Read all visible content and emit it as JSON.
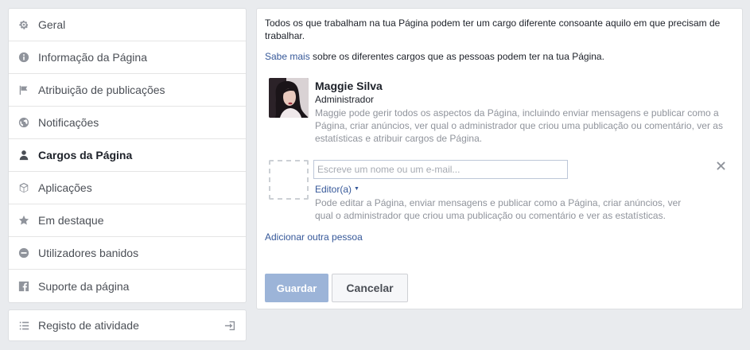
{
  "sidebar": {
    "items": [
      {
        "label": "Geral",
        "icon": "gear-icon"
      },
      {
        "label": "Informação da Página",
        "icon": "info-icon"
      },
      {
        "label": "Atribuição de publicações",
        "icon": "flag-icon"
      },
      {
        "label": "Notificações",
        "icon": "globe-icon"
      },
      {
        "label": "Cargos da Página",
        "icon": "person-icon",
        "active": true
      },
      {
        "label": "Aplicações",
        "icon": "cube-icon"
      },
      {
        "label": "Em destaque",
        "icon": "star-icon"
      },
      {
        "label": "Utilizadores banidos",
        "icon": "ban-icon"
      },
      {
        "label": "Suporte da página",
        "icon": "facebook-icon"
      }
    ],
    "activity_log": {
      "label": "Registo de atividade",
      "icon": "list-icon",
      "action_icon": "exit-icon"
    }
  },
  "main": {
    "intro": "Todos os que trabalham na tua Página podem ter um cargo diferente consoante aquilo em que precisam de trabalhar.",
    "learn_more_link": "Sabe mais",
    "learn_more_rest": " sobre os diferentes cargos que as pessoas podem ter na tua Página.",
    "user": {
      "name": "Maggie Silva",
      "role": "Administrador",
      "description": "Maggie pode gerir todos os aspectos da Página, incluindo enviar mensagens e publicar como a Página, criar anúncios, ver qual o administrador que criou uma publicação ou comentário, ver as estatísticas e atribuir cargos de Página."
    },
    "new_person": {
      "placeholder": "Escreve um nome ou um e-mail...",
      "value": "",
      "role": "Editor(a)",
      "description": "Pode editar a Página, enviar mensagens e publicar como a Página, criar anúncios, ver qual o administrador que criou uma publicação ou comentário e ver as estatísticas."
    },
    "add_person": "Adicionar outra pessoa",
    "save_label": "Guardar",
    "cancel_label": "Cancelar"
  },
  "colors": {
    "link": "#365899",
    "save_button": "#9cb4d8",
    "background": "#e9ebee"
  }
}
